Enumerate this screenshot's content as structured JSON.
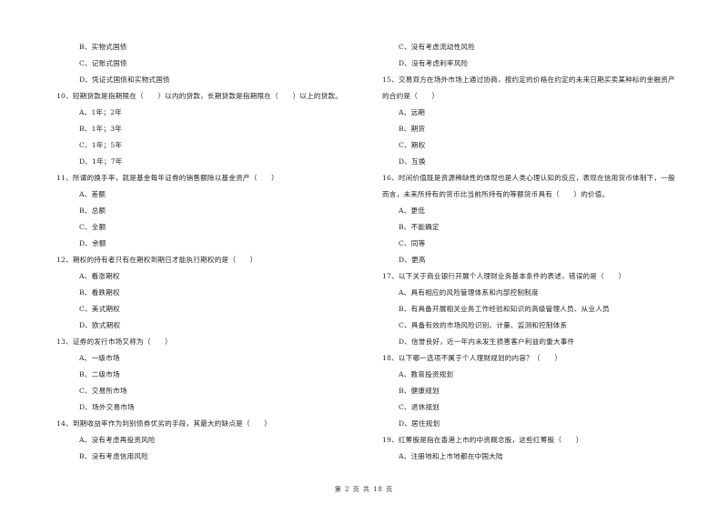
{
  "left_column": [
    {
      "type": "option",
      "text": "B、实物式国债"
    },
    {
      "type": "option",
      "text": "C、记账式国债"
    },
    {
      "type": "option",
      "text": "D、凭证式国债和实物式国债"
    },
    {
      "type": "question",
      "text": "10、短期贷款是指期限在（　　）以内的贷款，长期贷款是指期限在（　　）以上的贷款。"
    },
    {
      "type": "option",
      "text": "A、1年；2年"
    },
    {
      "type": "option",
      "text": "B、1年；3年"
    },
    {
      "type": "option",
      "text": "C、1年；5年"
    },
    {
      "type": "option",
      "text": "D、1年；7年"
    },
    {
      "type": "question",
      "text": "11、所谓的换手率，就是基金每年证券的销售额除以基金资产（　　）"
    },
    {
      "type": "option",
      "text": "A、差额"
    },
    {
      "type": "option",
      "text": "B、总额"
    },
    {
      "type": "option",
      "text": "C、全额"
    },
    {
      "type": "option",
      "text": "D、余额"
    },
    {
      "type": "question",
      "text": "12、期权的持有者只有在期权到期日才能执行期权的是（　　）"
    },
    {
      "type": "option",
      "text": "A、看涨期权"
    },
    {
      "type": "option",
      "text": "B、看跌期权"
    },
    {
      "type": "option",
      "text": "C、美式期权"
    },
    {
      "type": "option",
      "text": "D、欧式期权"
    },
    {
      "type": "question",
      "text": "13、证券的发行市场又称为（　　）"
    },
    {
      "type": "option",
      "text": "A、一级市场"
    },
    {
      "type": "option",
      "text": "B、二级市场"
    },
    {
      "type": "option",
      "text": "C、交易所市场"
    },
    {
      "type": "option",
      "text": "D、场外交易市场"
    },
    {
      "type": "question",
      "text": "14、到期收益率作为判别债券优劣的手段，其最大的缺点是（　　）"
    },
    {
      "type": "option",
      "text": "A、没有考虑再投资风险"
    },
    {
      "type": "option",
      "text": "B、没有考虑信用风险"
    }
  ],
  "right_column": [
    {
      "type": "option",
      "text": "C、没有考虑流动性风险"
    },
    {
      "type": "option",
      "text": "D、没有考虑利率风险"
    },
    {
      "type": "question",
      "text": "15、交易双方在场外市场上通过协商，按约定的价格在约定的未来日期买卖某种标的金融资产"
    },
    {
      "type": "question",
      "text": "的合约是（　　）"
    },
    {
      "type": "option",
      "text": "A、远期"
    },
    {
      "type": "option",
      "text": "B、期货"
    },
    {
      "type": "option",
      "text": "C、期权"
    },
    {
      "type": "option",
      "text": "D、互换"
    },
    {
      "type": "question",
      "text": "16、时间价值既是资源稀缺性的体现也是人类心理认知的反应，表现在信用货币体制下，一般"
    },
    {
      "type": "question",
      "text": "而言，未来所持有的货币比当前所持有的等额货币具有（　　）的价值。"
    },
    {
      "type": "option",
      "text": "A、更低"
    },
    {
      "type": "option",
      "text": "B、不能确定"
    },
    {
      "type": "option",
      "text": "C、同等"
    },
    {
      "type": "option",
      "text": "D、更高"
    },
    {
      "type": "question",
      "text": "17、以下关于商业银行开展个人理财业务基本条件的表述，错误的是（　　）"
    },
    {
      "type": "option",
      "text": "A、具有相应的风险管理体系和内部控制制度"
    },
    {
      "type": "option",
      "text": "B、有具备开展相关业务工作经验和知识的高级管理人员、从业人员"
    },
    {
      "type": "option",
      "text": "C、具备有效的市场风险识别、计量、监测和控制体系"
    },
    {
      "type": "option",
      "text": "D、信誉良好，近一年内未发生损害客户利益的重大事件"
    },
    {
      "type": "question",
      "text": "18、以下哪一选项不属于个人理财规划的内容？（　　）"
    },
    {
      "type": "option",
      "text": "A、教育投资规划"
    },
    {
      "type": "option",
      "text": "B、健康规划"
    },
    {
      "type": "option",
      "text": "C、退休规划"
    },
    {
      "type": "option",
      "text": "D、居住规划"
    },
    {
      "type": "question",
      "text": "19、红筹股是指在香港上市的中资概念股，这些红筹股（　　）"
    },
    {
      "type": "option",
      "text": "A、注册地和上市地都在中国大陆"
    }
  ],
  "footer": {
    "page_label": "第 2 页 共 18 页"
  }
}
